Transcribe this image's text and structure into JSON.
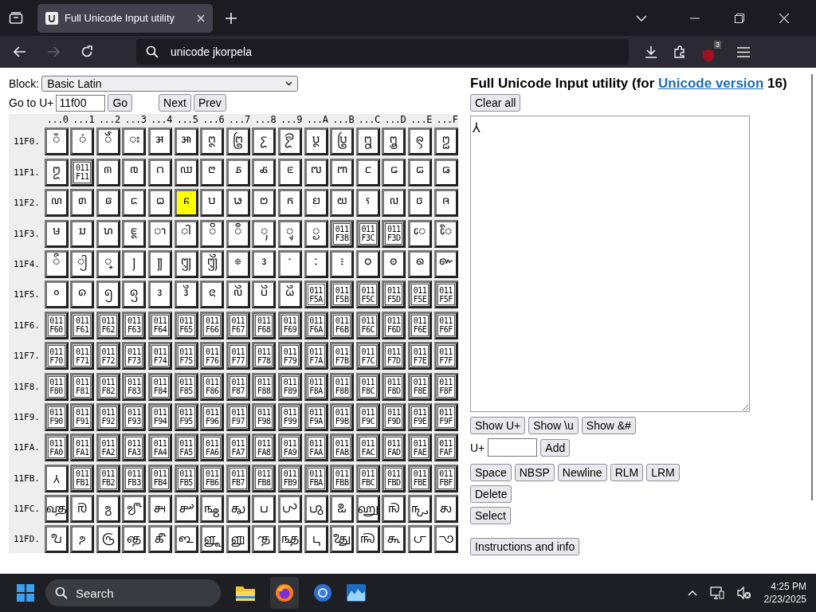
{
  "browser": {
    "tab": {
      "title": "Full Unicode Input utility",
      "selected": true
    },
    "address": {
      "value": "unicode jkorpela"
    },
    "extension_badge": "3"
  },
  "page": {
    "block": {
      "label": "Block:",
      "value": "Basic Latin"
    },
    "goto": {
      "label": "Go to U+",
      "value": "11f00",
      "buttons": [
        "Go",
        "Next",
        "Prev"
      ]
    },
    "columns": [
      "...0",
      "...1",
      "...2",
      "...3",
      "...4",
      "...5",
      "...6",
      "...7",
      "...8",
      "...9",
      "...A",
      "...B",
      "...C",
      "...D",
      "...E",
      "...F"
    ],
    "rows": [
      {
        "label": "11F0.",
        "cells": [
          {
            "kind": "glyph",
            "char": "𑼀",
            "assigned": true,
            "selected": false
          },
          {
            "kind": "glyph",
            "char": "𑼁",
            "assigned": true,
            "selected": false
          },
          {
            "kind": "glyph",
            "char": "𑼂",
            "assigned": true,
            "selected": false
          },
          {
            "kind": "glyph",
            "char": "𑼃",
            "assigned": true,
            "selected": false
          },
          {
            "kind": "glyph",
            "char": "𑼄",
            "assigned": true,
            "selected": false
          },
          {
            "kind": "glyph",
            "char": "𑼅",
            "assigned": true,
            "selected": false
          },
          {
            "kind": "glyph",
            "char": "𑼆",
            "assigned": true,
            "selected": false
          },
          {
            "kind": "glyph",
            "char": "𑼇",
            "assigned": true,
            "selected": false
          },
          {
            "kind": "glyph",
            "char": "𑼈",
            "assigned": true,
            "selected": false
          },
          {
            "kind": "glyph",
            "char": "𑼉",
            "assigned": true,
            "selected": false
          },
          {
            "kind": "glyph",
            "char": "𑼊",
            "assigned": true,
            "selected": false
          },
          {
            "kind": "glyph",
            "char": "𑼋",
            "assigned": true,
            "selected": false
          },
          {
            "kind": "glyph",
            "char": "𑼌",
            "assigned": true,
            "selected": false
          },
          {
            "kind": "glyph",
            "char": "𑼍",
            "assigned": true,
            "selected": false
          },
          {
            "kind": "glyph",
            "char": "𑼎",
            "assigned": true,
            "selected": false
          },
          {
            "kind": "glyph",
            "char": "𑼏",
            "assigned": true,
            "selected": false
          }
        ]
      },
      {
        "label": "11F1.",
        "cells": [
          {
            "kind": "glyph",
            "char": "𑼐",
            "assigned": true,
            "selected": false
          },
          {
            "kind": "missing",
            "code": "011F11",
            "assigned": false,
            "selected": false
          },
          {
            "kind": "glyph",
            "char": "𑼒",
            "assigned": true,
            "selected": false
          },
          {
            "kind": "glyph",
            "char": "𑼓",
            "assigned": true,
            "selected": false
          },
          {
            "kind": "glyph",
            "char": "𑼔",
            "assigned": true,
            "selected": false
          },
          {
            "kind": "glyph",
            "char": "𑼕",
            "assigned": true,
            "selected": false
          },
          {
            "kind": "glyph",
            "char": "𑼖",
            "assigned": true,
            "selected": false
          },
          {
            "kind": "glyph",
            "char": "𑼗",
            "assigned": true,
            "selected": false
          },
          {
            "kind": "glyph",
            "char": "𑼘",
            "assigned": true,
            "selected": false
          },
          {
            "kind": "glyph",
            "char": "𑼙",
            "assigned": true,
            "selected": false
          },
          {
            "kind": "glyph",
            "char": "𑼚",
            "assigned": true,
            "selected": false
          },
          {
            "kind": "glyph",
            "char": "𑼛",
            "assigned": true,
            "selected": false
          },
          {
            "kind": "glyph",
            "char": "𑼜",
            "assigned": true,
            "selected": false
          },
          {
            "kind": "glyph",
            "char": "𑼝",
            "assigned": true,
            "selected": false
          },
          {
            "kind": "glyph",
            "char": "𑼞",
            "assigned": true,
            "selected": false
          },
          {
            "kind": "glyph",
            "char": "𑼟",
            "assigned": true,
            "selected": false
          }
        ]
      },
      {
        "label": "11F2.",
        "cells": [
          {
            "kind": "glyph",
            "char": "𑼠",
            "assigned": true,
            "selected": false
          },
          {
            "kind": "glyph",
            "char": "𑼡",
            "assigned": true,
            "selected": false
          },
          {
            "kind": "glyph",
            "char": "𑼢",
            "assigned": true,
            "selected": false
          },
          {
            "kind": "glyph",
            "char": "𑼣",
            "assigned": true,
            "selected": false
          },
          {
            "kind": "glyph",
            "char": "𑼤",
            "assigned": true,
            "selected": false
          },
          {
            "kind": "glyph",
            "char": "𑼥",
            "assigned": true,
            "selected": true
          },
          {
            "kind": "glyph",
            "char": "𑼦",
            "assigned": true,
            "selected": false
          },
          {
            "kind": "glyph",
            "char": "𑼧",
            "assigned": true,
            "selected": false
          },
          {
            "kind": "glyph",
            "char": "𑼨",
            "assigned": true,
            "selected": false
          },
          {
            "kind": "glyph",
            "char": "𑼩",
            "assigned": true,
            "selected": false
          },
          {
            "kind": "glyph",
            "char": "𑼪",
            "assigned": true,
            "selected": false
          },
          {
            "kind": "glyph",
            "char": "𑼫",
            "assigned": true,
            "selected": false
          },
          {
            "kind": "glyph",
            "char": "𑼬",
            "assigned": true,
            "selected": false
          },
          {
            "kind": "glyph",
            "char": "𑼭",
            "assigned": true,
            "selected": false
          },
          {
            "kind": "glyph",
            "char": "𑼮",
            "assigned": true,
            "selected": false
          },
          {
            "kind": "glyph",
            "char": "𑼯",
            "assigned": true,
            "selected": false
          }
        ]
      },
      {
        "label": "11F3.",
        "cells": [
          {
            "kind": "glyph",
            "char": "𑼰",
            "assigned": true,
            "selected": false
          },
          {
            "kind": "glyph",
            "char": "𑼱",
            "assigned": true,
            "selected": false
          },
          {
            "kind": "glyph",
            "char": "𑼲",
            "assigned": true,
            "selected": false
          },
          {
            "kind": "glyph",
            "char": "𑼳",
            "assigned": true,
            "selected": false
          },
          {
            "kind": "glyph",
            "char": "𑼴",
            "assigned": true,
            "selected": false
          },
          {
            "kind": "glyph",
            "char": "𑼵",
            "assigned": true,
            "selected": false
          },
          {
            "kind": "glyph",
            "char": "𑼶",
            "assigned": true,
            "selected": false
          },
          {
            "kind": "glyph",
            "char": "𑼷",
            "assigned": true,
            "selected": false
          },
          {
            "kind": "glyph",
            "char": "𑼸",
            "assigned": true,
            "selected": false
          },
          {
            "kind": "glyph",
            "char": "𑼹",
            "assigned": true,
            "selected": false
          },
          {
            "kind": "glyph",
            "char": "𑼺",
            "assigned": true,
            "selected": false
          },
          {
            "kind": "missing",
            "code": "011F3B",
            "assigned": false,
            "selected": false
          },
          {
            "kind": "missing",
            "code": "011F3C",
            "assigned": false,
            "selected": false
          },
          {
            "kind": "missing",
            "code": "011F3D",
            "assigned": false,
            "selected": false
          },
          {
            "kind": "glyph",
            "char": "𑼾",
            "assigned": true,
            "selected": false
          },
          {
            "kind": "glyph",
            "char": "𑼿",
            "assigned": true,
            "selected": false
          }
        ]
      },
      {
        "label": "11F4.",
        "cells": [
          {
            "kind": "glyph",
            "char": "𑽀",
            "assigned": true,
            "selected": false
          },
          {
            "kind": "glyph",
            "char": "𑽁",
            "assigned": true,
            "selected": false
          },
          {
            "kind": "glyph",
            "char": "𑽂",
            "assigned": true,
            "selected": false
          },
          {
            "kind": "glyph",
            "char": "𑽃",
            "assigned": true,
            "selected": false
          },
          {
            "kind": "glyph",
            "char": "𑽄",
            "assigned": true,
            "selected": false
          },
          {
            "kind": "glyph",
            "char": "𑽅",
            "assigned": true,
            "selected": false
          },
          {
            "kind": "glyph",
            "char": "𑽆",
            "assigned": true,
            "selected": false
          },
          {
            "kind": "glyph",
            "char": "𑽇",
            "assigned": true,
            "selected": false
          },
          {
            "kind": "glyph",
            "char": "𑽈",
            "assigned": true,
            "selected": false
          },
          {
            "kind": "glyph",
            "char": "𑽉",
            "assigned": true,
            "selected": false
          },
          {
            "kind": "glyph",
            "char": "𑽊",
            "assigned": true,
            "selected": false
          },
          {
            "kind": "glyph",
            "char": "𑽋",
            "assigned": true,
            "selected": false
          },
          {
            "kind": "glyph",
            "char": "𑽌",
            "assigned": true,
            "selected": false
          },
          {
            "kind": "glyph",
            "char": "𑽍",
            "assigned": true,
            "selected": false
          },
          {
            "kind": "glyph",
            "char": "𑽎",
            "assigned": true,
            "selected": false
          },
          {
            "kind": "glyph",
            "char": "𑽏",
            "assigned": true,
            "selected": false
          }
        ]
      },
      {
        "label": "11F5.",
        "cells": [
          {
            "kind": "glyph",
            "char": "𑽐",
            "assigned": true,
            "selected": false
          },
          {
            "kind": "glyph",
            "char": "𑽑",
            "assigned": true,
            "selected": false
          },
          {
            "kind": "glyph",
            "char": "𑽒",
            "assigned": true,
            "selected": false
          },
          {
            "kind": "glyph",
            "char": "𑽓",
            "assigned": true,
            "selected": false
          },
          {
            "kind": "glyph",
            "char": "𑽔",
            "assigned": true,
            "selected": false
          },
          {
            "kind": "glyph",
            "char": "𑽕",
            "assigned": true,
            "selected": false
          },
          {
            "kind": "glyph",
            "char": "𑽖",
            "assigned": true,
            "selected": false
          },
          {
            "kind": "glyph",
            "char": "𑽗",
            "assigned": true,
            "selected": false
          },
          {
            "kind": "glyph",
            "char": "𑽘",
            "assigned": true,
            "selected": false
          },
          {
            "kind": "glyph",
            "char": "𑽙",
            "assigned": true,
            "selected": false
          },
          {
            "kind": "missing",
            "code": "011F5A",
            "assigned": true,
            "selected": false
          },
          {
            "kind": "missing",
            "code": "011F5B",
            "assigned": false,
            "selected": false
          },
          {
            "kind": "missing",
            "code": "011F5C",
            "assigned": false,
            "selected": false
          },
          {
            "kind": "missing",
            "code": "011F5D",
            "assigned": false,
            "selected": false
          },
          {
            "kind": "missing",
            "code": "011F5E",
            "assigned": false,
            "selected": false
          },
          {
            "kind": "missing",
            "code": "011F5F",
            "assigned": false,
            "selected": false
          }
        ]
      },
      {
        "label": "11F6.",
        "cells": [
          {
            "kind": "missing",
            "code": "011F60",
            "assigned": false,
            "selected": false
          },
          {
            "kind": "missing",
            "code": "011F61",
            "assigned": false,
            "selected": false
          },
          {
            "kind": "missing",
            "code": "011F62",
            "assigned": false,
            "selected": false
          },
          {
            "kind": "missing",
            "code": "011F63",
            "assigned": false,
            "selected": false
          },
          {
            "kind": "missing",
            "code": "011F64",
            "assigned": false,
            "selected": false
          },
          {
            "kind": "missing",
            "code": "011F65",
            "assigned": false,
            "selected": false
          },
          {
            "kind": "missing",
            "code": "011F66",
            "assigned": false,
            "selected": false
          },
          {
            "kind": "missing",
            "code": "011F67",
            "assigned": false,
            "selected": false
          },
          {
            "kind": "missing",
            "code": "011F68",
            "assigned": false,
            "selected": false
          },
          {
            "kind": "missing",
            "code": "011F69",
            "assigned": false,
            "selected": false
          },
          {
            "kind": "missing",
            "code": "011F6A",
            "assigned": false,
            "selected": false
          },
          {
            "kind": "missing",
            "code": "011F6B",
            "assigned": false,
            "selected": false
          },
          {
            "kind": "missing",
            "code": "011F6C",
            "assigned": false,
            "selected": false
          },
          {
            "kind": "missing",
            "code": "011F6D",
            "assigned": false,
            "selected": false
          },
          {
            "kind": "missing",
            "code": "011F6E",
            "assigned": false,
            "selected": false
          },
          {
            "kind": "missing",
            "code": "011F6F",
            "assigned": false,
            "selected": false
          }
        ]
      },
      {
        "label": "11F7.",
        "cells": [
          {
            "kind": "missing",
            "code": "011F70",
            "assigned": false,
            "selected": false
          },
          {
            "kind": "missing",
            "code": "011F71",
            "assigned": false,
            "selected": false
          },
          {
            "kind": "missing",
            "code": "011F72",
            "assigned": false,
            "selected": false
          },
          {
            "kind": "missing",
            "code": "011F73",
            "assigned": false,
            "selected": false
          },
          {
            "kind": "missing",
            "code": "011F74",
            "assigned": false,
            "selected": false
          },
          {
            "kind": "missing",
            "code": "011F75",
            "assigned": false,
            "selected": false
          },
          {
            "kind": "missing",
            "code": "011F76",
            "assigned": false,
            "selected": false
          },
          {
            "kind": "missing",
            "code": "011F77",
            "assigned": false,
            "selected": false
          },
          {
            "kind": "missing",
            "code": "011F78",
            "assigned": false,
            "selected": false
          },
          {
            "kind": "missing",
            "code": "011F79",
            "assigned": false,
            "selected": false
          },
          {
            "kind": "missing",
            "code": "011F7A",
            "assigned": false,
            "selected": false
          },
          {
            "kind": "missing",
            "code": "011F7B",
            "assigned": false,
            "selected": false
          },
          {
            "kind": "missing",
            "code": "011F7C",
            "assigned": false,
            "selected": false
          },
          {
            "kind": "missing",
            "code": "011F7D",
            "assigned": false,
            "selected": false
          },
          {
            "kind": "missing",
            "code": "011F7E",
            "assigned": false,
            "selected": false
          },
          {
            "kind": "missing",
            "code": "011F7F",
            "assigned": false,
            "selected": false
          }
        ]
      },
      {
        "label": "11F8.",
        "cells": [
          {
            "kind": "missing",
            "code": "011F80",
            "assigned": false,
            "selected": false
          },
          {
            "kind": "missing",
            "code": "011F81",
            "assigned": false,
            "selected": false
          },
          {
            "kind": "missing",
            "code": "011F82",
            "assigned": false,
            "selected": false
          },
          {
            "kind": "missing",
            "code": "011F83",
            "assigned": false,
            "selected": false
          },
          {
            "kind": "missing",
            "code": "011F84",
            "assigned": false,
            "selected": false
          },
          {
            "kind": "missing",
            "code": "011F85",
            "assigned": false,
            "selected": false
          },
          {
            "kind": "missing",
            "code": "011F86",
            "assigned": false,
            "selected": false
          },
          {
            "kind": "missing",
            "code": "011F87",
            "assigned": false,
            "selected": false
          },
          {
            "kind": "missing",
            "code": "011F88",
            "assigned": false,
            "selected": false
          },
          {
            "kind": "missing",
            "code": "011F89",
            "assigned": false,
            "selected": false
          },
          {
            "kind": "missing",
            "code": "011F8A",
            "assigned": false,
            "selected": false
          },
          {
            "kind": "missing",
            "code": "011F8B",
            "assigned": false,
            "selected": false
          },
          {
            "kind": "missing",
            "code": "011F8C",
            "assigned": false,
            "selected": false
          },
          {
            "kind": "missing",
            "code": "011F8D",
            "assigned": false,
            "selected": false
          },
          {
            "kind": "missing",
            "code": "011F8E",
            "assigned": false,
            "selected": false
          },
          {
            "kind": "missing",
            "code": "011F8F",
            "assigned": false,
            "selected": false
          }
        ]
      },
      {
        "label": "11F9.",
        "cells": [
          {
            "kind": "missing",
            "code": "011F90",
            "assigned": false,
            "selected": false
          },
          {
            "kind": "missing",
            "code": "011F91",
            "assigned": false,
            "selected": false
          },
          {
            "kind": "missing",
            "code": "011F92",
            "assigned": false,
            "selected": false
          },
          {
            "kind": "missing",
            "code": "011F93",
            "assigned": false,
            "selected": false
          },
          {
            "kind": "missing",
            "code": "011F94",
            "assigned": false,
            "selected": false
          },
          {
            "kind": "missing",
            "code": "011F95",
            "assigned": false,
            "selected": false
          },
          {
            "kind": "missing",
            "code": "011F96",
            "assigned": false,
            "selected": false
          },
          {
            "kind": "missing",
            "code": "011F97",
            "assigned": false,
            "selected": false
          },
          {
            "kind": "missing",
            "code": "011F98",
            "assigned": false,
            "selected": false
          },
          {
            "kind": "missing",
            "code": "011F99",
            "assigned": false,
            "selected": false
          },
          {
            "kind": "missing",
            "code": "011F9A",
            "assigned": false,
            "selected": false
          },
          {
            "kind": "missing",
            "code": "011F9B",
            "assigned": false,
            "selected": false
          },
          {
            "kind": "missing",
            "code": "011F9C",
            "assigned": false,
            "selected": false
          },
          {
            "kind": "missing",
            "code": "011F9D",
            "assigned": false,
            "selected": false
          },
          {
            "kind": "missing",
            "code": "011F9E",
            "assigned": false,
            "selected": false
          },
          {
            "kind": "missing",
            "code": "011F9F",
            "assigned": false,
            "selected": false
          }
        ]
      },
      {
        "label": "11FA.",
        "cells": [
          {
            "kind": "missing",
            "code": "011FA0",
            "assigned": false,
            "selected": false
          },
          {
            "kind": "missing",
            "code": "011FA1",
            "assigned": false,
            "selected": false
          },
          {
            "kind": "missing",
            "code": "011FA2",
            "assigned": false,
            "selected": false
          },
          {
            "kind": "missing",
            "code": "011FA3",
            "assigned": false,
            "selected": false
          },
          {
            "kind": "missing",
            "code": "011FA4",
            "assigned": false,
            "selected": false
          },
          {
            "kind": "missing",
            "code": "011FA5",
            "assigned": false,
            "selected": false
          },
          {
            "kind": "missing",
            "code": "011FA6",
            "assigned": false,
            "selected": false
          },
          {
            "kind": "missing",
            "code": "011FA7",
            "assigned": false,
            "selected": false
          },
          {
            "kind": "missing",
            "code": "011FA8",
            "assigned": false,
            "selected": false
          },
          {
            "kind": "missing",
            "code": "011FA9",
            "assigned": false,
            "selected": false
          },
          {
            "kind": "missing",
            "code": "011FAA",
            "assigned": false,
            "selected": false
          },
          {
            "kind": "missing",
            "code": "011FAB",
            "assigned": false,
            "selected": false
          },
          {
            "kind": "missing",
            "code": "011FAC",
            "assigned": false,
            "selected": false
          },
          {
            "kind": "missing",
            "code": "011FAD",
            "assigned": false,
            "selected": false
          },
          {
            "kind": "missing",
            "code": "011FAE",
            "assigned": false,
            "selected": false
          },
          {
            "kind": "missing",
            "code": "011FAF",
            "assigned": false,
            "selected": false
          }
        ]
      },
      {
        "label": "11FB.",
        "cells": [
          {
            "kind": "glyph",
            "char": "𑾰",
            "assigned": true,
            "selected": false
          },
          {
            "kind": "missing",
            "code": "011FB1",
            "assigned": false,
            "selected": false
          },
          {
            "kind": "missing",
            "code": "011FB2",
            "assigned": false,
            "selected": false
          },
          {
            "kind": "missing",
            "code": "011FB3",
            "assigned": false,
            "selected": false
          },
          {
            "kind": "missing",
            "code": "011FB4",
            "assigned": false,
            "selected": false
          },
          {
            "kind": "missing",
            "code": "011FB5",
            "assigned": false,
            "selected": false
          },
          {
            "kind": "missing",
            "code": "011FB6",
            "assigned": false,
            "selected": false
          },
          {
            "kind": "missing",
            "code": "011FB7",
            "assigned": false,
            "selected": false
          },
          {
            "kind": "missing",
            "code": "011FB8",
            "assigned": false,
            "selected": false
          },
          {
            "kind": "missing",
            "code": "011FB9",
            "assigned": false,
            "selected": false
          },
          {
            "kind": "missing",
            "code": "011FBA",
            "assigned": false,
            "selected": false
          },
          {
            "kind": "missing",
            "code": "011FBB",
            "assigned": false,
            "selected": false
          },
          {
            "kind": "missing",
            "code": "011FBC",
            "assigned": false,
            "selected": false
          },
          {
            "kind": "missing",
            "code": "011FBD",
            "assigned": false,
            "selected": false
          },
          {
            "kind": "missing",
            "code": "011FBE",
            "assigned": false,
            "selected": false
          },
          {
            "kind": "missing",
            "code": "011FBF",
            "assigned": false,
            "selected": false
          }
        ]
      },
      {
        "label": "11FC.",
        "cells": [
          {
            "kind": "glyph",
            "char": "𑿀",
            "assigned": true,
            "selected": false
          },
          {
            "kind": "glyph",
            "char": "𑿁",
            "assigned": true,
            "selected": false
          },
          {
            "kind": "glyph",
            "char": "𑿂",
            "assigned": true,
            "selected": false
          },
          {
            "kind": "glyph",
            "char": "𑿃",
            "assigned": true,
            "selected": false
          },
          {
            "kind": "glyph",
            "char": "𑿄",
            "assigned": true,
            "selected": false
          },
          {
            "kind": "glyph",
            "char": "𑿅",
            "assigned": true,
            "selected": false
          },
          {
            "kind": "glyph",
            "char": "𑿆",
            "assigned": true,
            "selected": false
          },
          {
            "kind": "glyph",
            "char": "𑿇",
            "assigned": true,
            "selected": false
          },
          {
            "kind": "glyph",
            "char": "𑿈",
            "assigned": true,
            "selected": false
          },
          {
            "kind": "glyph",
            "char": "𑿉",
            "assigned": true,
            "selected": false
          },
          {
            "kind": "glyph",
            "char": "𑿊",
            "assigned": true,
            "selected": false
          },
          {
            "kind": "glyph",
            "char": "𑿋",
            "assigned": true,
            "selected": false
          },
          {
            "kind": "glyph",
            "char": "𑿌",
            "assigned": true,
            "selected": false
          },
          {
            "kind": "glyph",
            "char": "𑿍",
            "assigned": true,
            "selected": false
          },
          {
            "kind": "glyph",
            "char": "𑿎",
            "assigned": true,
            "selected": false
          },
          {
            "kind": "glyph",
            "char": "𑿏",
            "assigned": true,
            "selected": false
          }
        ]
      },
      {
        "label": "11FD.",
        "cells": [
          {
            "kind": "glyph",
            "char": "𑿐",
            "assigned": true,
            "selected": false
          },
          {
            "kind": "glyph",
            "char": "𑿑",
            "assigned": true,
            "selected": false
          },
          {
            "kind": "glyph",
            "char": "𑿒",
            "assigned": true,
            "selected": false
          },
          {
            "kind": "glyph",
            "char": "𑿓",
            "assigned": true,
            "selected": false
          },
          {
            "kind": "glyph",
            "char": "𑿔",
            "assigned": true,
            "selected": false
          },
          {
            "kind": "glyph",
            "char": "𑿕",
            "assigned": true,
            "selected": false
          },
          {
            "kind": "glyph",
            "char": "𑿖",
            "assigned": true,
            "selected": false
          },
          {
            "kind": "glyph",
            "char": "𑿗",
            "assigned": true,
            "selected": false
          },
          {
            "kind": "glyph",
            "char": "𑿘",
            "assigned": true,
            "selected": false
          },
          {
            "kind": "glyph",
            "char": "𑿙",
            "assigned": true,
            "selected": false
          },
          {
            "kind": "glyph",
            "char": "𑿚",
            "assigned": true,
            "selected": false
          },
          {
            "kind": "glyph",
            "char": "𑿛",
            "assigned": true,
            "selected": false
          },
          {
            "kind": "glyph",
            "char": "𑿜",
            "assigned": true,
            "selected": false
          },
          {
            "kind": "glyph",
            "char": "𑿝",
            "assigned": true,
            "selected": false
          },
          {
            "kind": "glyph",
            "char": "𑿞",
            "assigned": true,
            "selected": false
          },
          {
            "kind": "glyph",
            "char": "𑿟",
            "assigned": true,
            "selected": false
          }
        ]
      }
    ],
    "title": {
      "text": "Full Unicode Input utility (for ",
      "link": "Unicode version",
      "suffix": " 16)"
    },
    "clear_button": "Clear all",
    "output": {
      "value": "𑾰"
    },
    "show_buttons": [
      "Show U+",
      "Show \\u",
      "Show &#"
    ],
    "add": {
      "label": "U+",
      "button": "Add"
    },
    "insert_buttons": [
      "Space",
      "NBSP",
      "Newline",
      "RLM",
      "LRM"
    ],
    "delete_button": "Delete",
    "select_button": "Select",
    "info_button": "Instructions and info"
  },
  "taskbar": {
    "search": {
      "placeholder": "Search"
    },
    "time": "4:25 PM",
    "date": "2/23/2025"
  }
}
